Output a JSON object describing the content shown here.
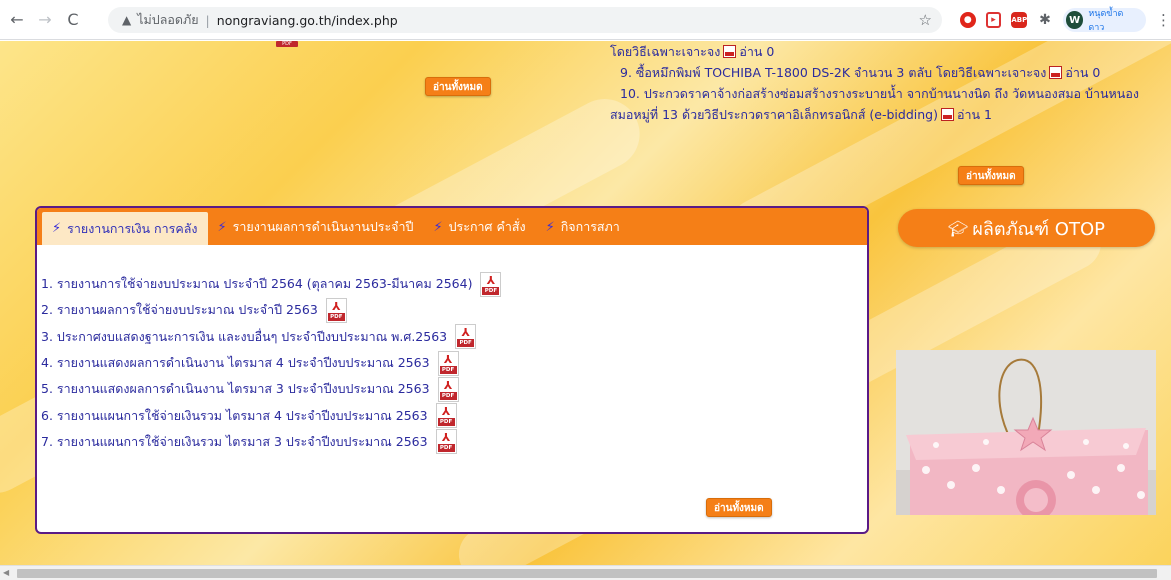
{
  "browser": {
    "nav": {
      "back": "←",
      "forward": "→",
      "reload": "C"
    },
    "security_label": "ไม่ปลอดภัย",
    "url": "nongraviang.go.th/index.php",
    "profile_initial": "W",
    "profile_name": "หนุดข้ำดดาว"
  },
  "page": {
    "read_all_label": "อ่านทั้งหมด",
    "procurement": {
      "line_top": "โดยวิธีเฉพาะเจาะจง",
      "line_top_reads": "อ่าน 0",
      "item9": "9.  ซื้อหมึกพิมพ์ TOCHIBA T-1800 DS-2K จำนวน 3 ตลับ โดยวิธีเฉพาะเจาะจง",
      "item9_reads": "อ่าน 0",
      "item10_a": "10.  ประกวดราคาจ้างก่อสร้างซ่อมสร้างรางระบายน้ำ จากบ้านนางนิด ถึง วัดหนองสมอ บ้านหนอง",
      "item10_b": "สมอหมู่ที่ 13 ด้วยวิธีประกวดราคาอิเล็กทรอนิกส์ (e-bidding)",
      "item10_reads": "อ่าน 1"
    },
    "tabs": [
      {
        "label": "รายงานการเงิน การคลัง",
        "icon": "bolt-icon"
      },
      {
        "label": "รายงานผลการดำเนินงานประจำปี",
        "icon": "bolt-icon"
      },
      {
        "label": "ประกาศ คำสั่ง",
        "icon": "bolt-icon"
      },
      {
        "label": "กิจการสภา",
        "icon": "bolt-icon"
      }
    ],
    "reports": [
      "1. รายงานการใช้จ่ายงบประมาณ ประจำปี 2564 (ตุลาคม 2563-มีนาคม 2564)",
      "2. รายงานผลการใช้จ่ายงบประมาณ ประจำปี 2563",
      "3. ประกาศงบแสดงฐานะการเงิน และงบอื่นๆ ประจำปีงบประมาณ พ.ศ.2563",
      "4. รายงานแสดงผลการดำเนินงาน ไตรมาส 4 ประจำปีงบประมาณ 2563",
      "5. รายงานแสดงผลการดำเนินงาน ไตรมาส 3 ประจำปีงบประมาณ 2563",
      "6. รายงานแผนการใช้จ่ายเงินรวม ไตรมาส 4 ประจำปีงบประมาณ 2563",
      "7. รายงานแผนการใช้จ่ายเงินรวม ไตรมาส 3 ประจำปีงบประมาณ 2563"
    ],
    "pdf_label": "PDF",
    "otop_title": "ผลิตภัณฑ์ OTOP"
  },
  "colors": {
    "accent_orange": "#f57f17",
    "panel_border": "#5a1a86",
    "link_blue": "#2b2b9e"
  }
}
